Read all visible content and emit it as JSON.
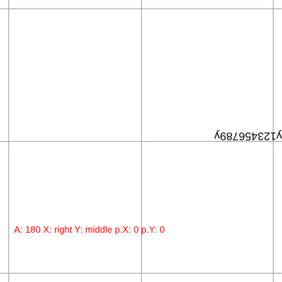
{
  "rotated_label": "y123456789y",
  "info_text": "A: 180 X: right Y: middle p.X: 0 p.Y: 0",
  "colors": {
    "grid": "#a0a0a0",
    "text": "#000000",
    "info": "#ff0000"
  }
}
